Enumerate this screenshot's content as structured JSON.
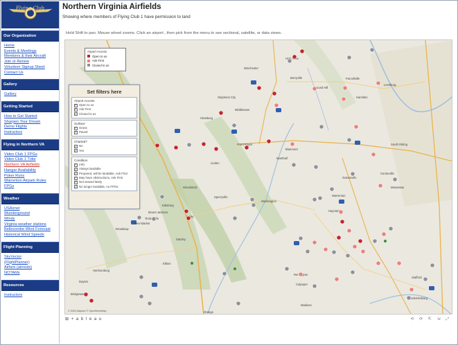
{
  "app": {
    "page_title": "Northern Virginia Airfields",
    "subtitle": "Showing where members of Flying Club 1 have permission to land",
    "logo_text": "Flying Club"
  },
  "colors": {
    "nav_bg": "#1b3c84",
    "open": "#c0272d",
    "ask_first": "#e7837c",
    "closed": "#8e9296"
  },
  "sidebar": {
    "sections": [
      {
        "title": "Our Organization",
        "items": [
          "Home",
          "Events & Meetings",
          "Members & their Aircraft",
          "Join or Renew",
          "Volunteer Signup Sheet",
          "Contact Us"
        ]
      },
      {
        "title": "Gallery",
        "items": [
          "Gallery"
        ]
      },
      {
        "title": "Getting Started",
        "items": [
          "How to Get Started",
          "Sharpen Your Dream",
          "Demo Flights",
          "Instructors"
        ]
      },
      {
        "title": "Flying in Northern VA",
        "items": [
          "Video Club 1 FPGs",
          "Video Club 1 Trike",
          "Northern VA Airfields",
          "Hangar Availability",
          "Poker Runs",
          "Warrenton Airpark Rules",
          "FPGs"
        ]
      },
      {
        "title": "Weather",
        "items": [
          "USAirnet",
          "Wunderground",
          "Windy",
          "Virginia weather stations",
          "Bellecombe Wind Forecast",
          "Historical Wind Speeds"
        ]
      },
      {
        "title": "Flight Planning",
        "items": [
          "SkyVector",
          "(FlightPlanner)",
          "Airfare (airnods)",
          "NOTAMs"
        ]
      },
      {
        "title": "Resources",
        "items": [
          "Instructors"
        ]
      }
    ],
    "selected": "Northern VA Airfields"
  },
  "map": {
    "instructions": "Hold Shift to pan.  Mouse wheel zooms.  Click an airport , then pick from the menu to see sectional, satellite, or data views.",
    "credit": "© 2020 Mapbox  © OpenStreetMap",
    "legend": {
      "title": "Airport Access",
      "items": [
        "Open to us",
        "Ask First",
        "Closed to us"
      ]
    },
    "filters": {
      "title": "Set filters here",
      "groups": [
        {
          "title": "Airport Access",
          "items": [
            "Open to us",
            "Ask First",
            "Closed to us"
          ]
        },
        {
          "title": "Surface",
          "items": [
            "Grass",
            "Paved"
          ]
        },
        {
          "title": "Charted?",
          "items": [
            "No",
            "Yes"
          ]
        },
        {
          "title": "Condition",
          "items": [
            "(All)",
            "Always landable",
            "Prepared, will be landable, Ask First",
            "May have obstructions, Ask First",
            "Not viewed lately",
            "No longer landable, no FPGs"
          ]
        }
      ]
    },
    "towns": [
      "High View",
      "Winchester",
      "Berryville",
      "Purcellville",
      "Leesburg",
      "Stephens City",
      "Round Hill",
      "Hamilton",
      "Middletown",
      "Strasburg",
      "Front Royal",
      "Bluemont",
      "Marshall",
      "South Riding",
      "Centreville",
      "Woodstock",
      "Edinburg",
      "Mount Jackson",
      "New Market",
      "Luray",
      "Washington",
      "Warrenton",
      "Manassas",
      "Broadway",
      "Timberville",
      "Harrisonburg",
      "Elkton",
      "Stanley",
      "Culpeper",
      "Remington",
      "Stafford",
      "Fredericksburg",
      "Bridgewater",
      "Dayton",
      "Orange",
      "Madison",
      "Sperryville",
      "Gainesville",
      "Haymarket",
      "Linden"
    ],
    "footer": "⊞ + a b l e a u",
    "footer_tools": "⟲ ⟳ ⇱ ⇲ ⤢"
  }
}
